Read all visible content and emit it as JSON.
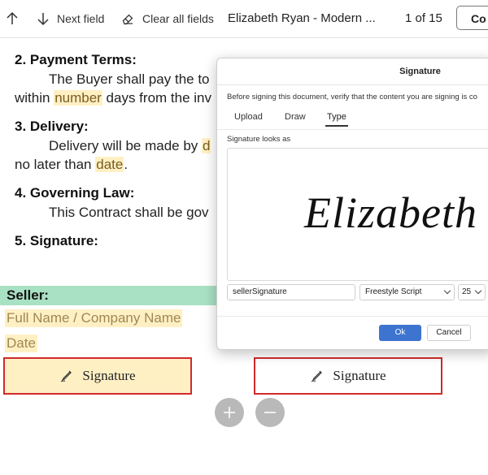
{
  "toolbar": {
    "up_icon": "arrow-up-icon",
    "next_field_label": "Next field",
    "clear_all_label": "Clear all fields",
    "document_title": "Elizabeth Ryan - Modern ...",
    "page_indicator": "1 of 15",
    "continue_label": "Co"
  },
  "document": {
    "section2_heading": "2. Payment Terms:",
    "section2_line1": "The Buyer shall pay the to",
    "section2_line2_a": "within ",
    "section2_line2_field": "number",
    "section2_line2_b": " days from the inv",
    "section3_heading": "3. Delivery:",
    "section3_line1_a": "Delivery will be made by ",
    "section3_line1_field": "d",
    "section3_line2_a": "no later than ",
    "section3_line2_field": "date",
    "section3_line2_b": ".",
    "section4_heading": "4. Governing Law:",
    "section4_line1": "This Contract shall be gov",
    "section5_heading": "5. Signature:",
    "seller_label": "Seller:",
    "full_name_field": "Full Name / Company Name",
    "date_field": "Date",
    "seller_signature_label": "Signature",
    "buyer_signature_label": "Signature"
  },
  "dialog": {
    "title": "Signature",
    "notice": "Before signing this document, verify that the content you are signing is co",
    "tabs": [
      "Upload",
      "Draw",
      "Type"
    ],
    "active_tab": "Type",
    "looks_label": "Signature looks as",
    "preview_text": "Elizabeth Ry",
    "name_value": "sellerSignature",
    "font_value": "Freestyle Script",
    "size_value": "25",
    "ok_label": "Ok",
    "cancel_label": "Cancel"
  },
  "colors": {
    "field_highlight": "#fff0c4",
    "seller_bar": "#a8e1c3",
    "signature_border": "#d12a2a",
    "ok_button": "#3c74d0",
    "zoom_buttons": "#b9b9b9"
  }
}
